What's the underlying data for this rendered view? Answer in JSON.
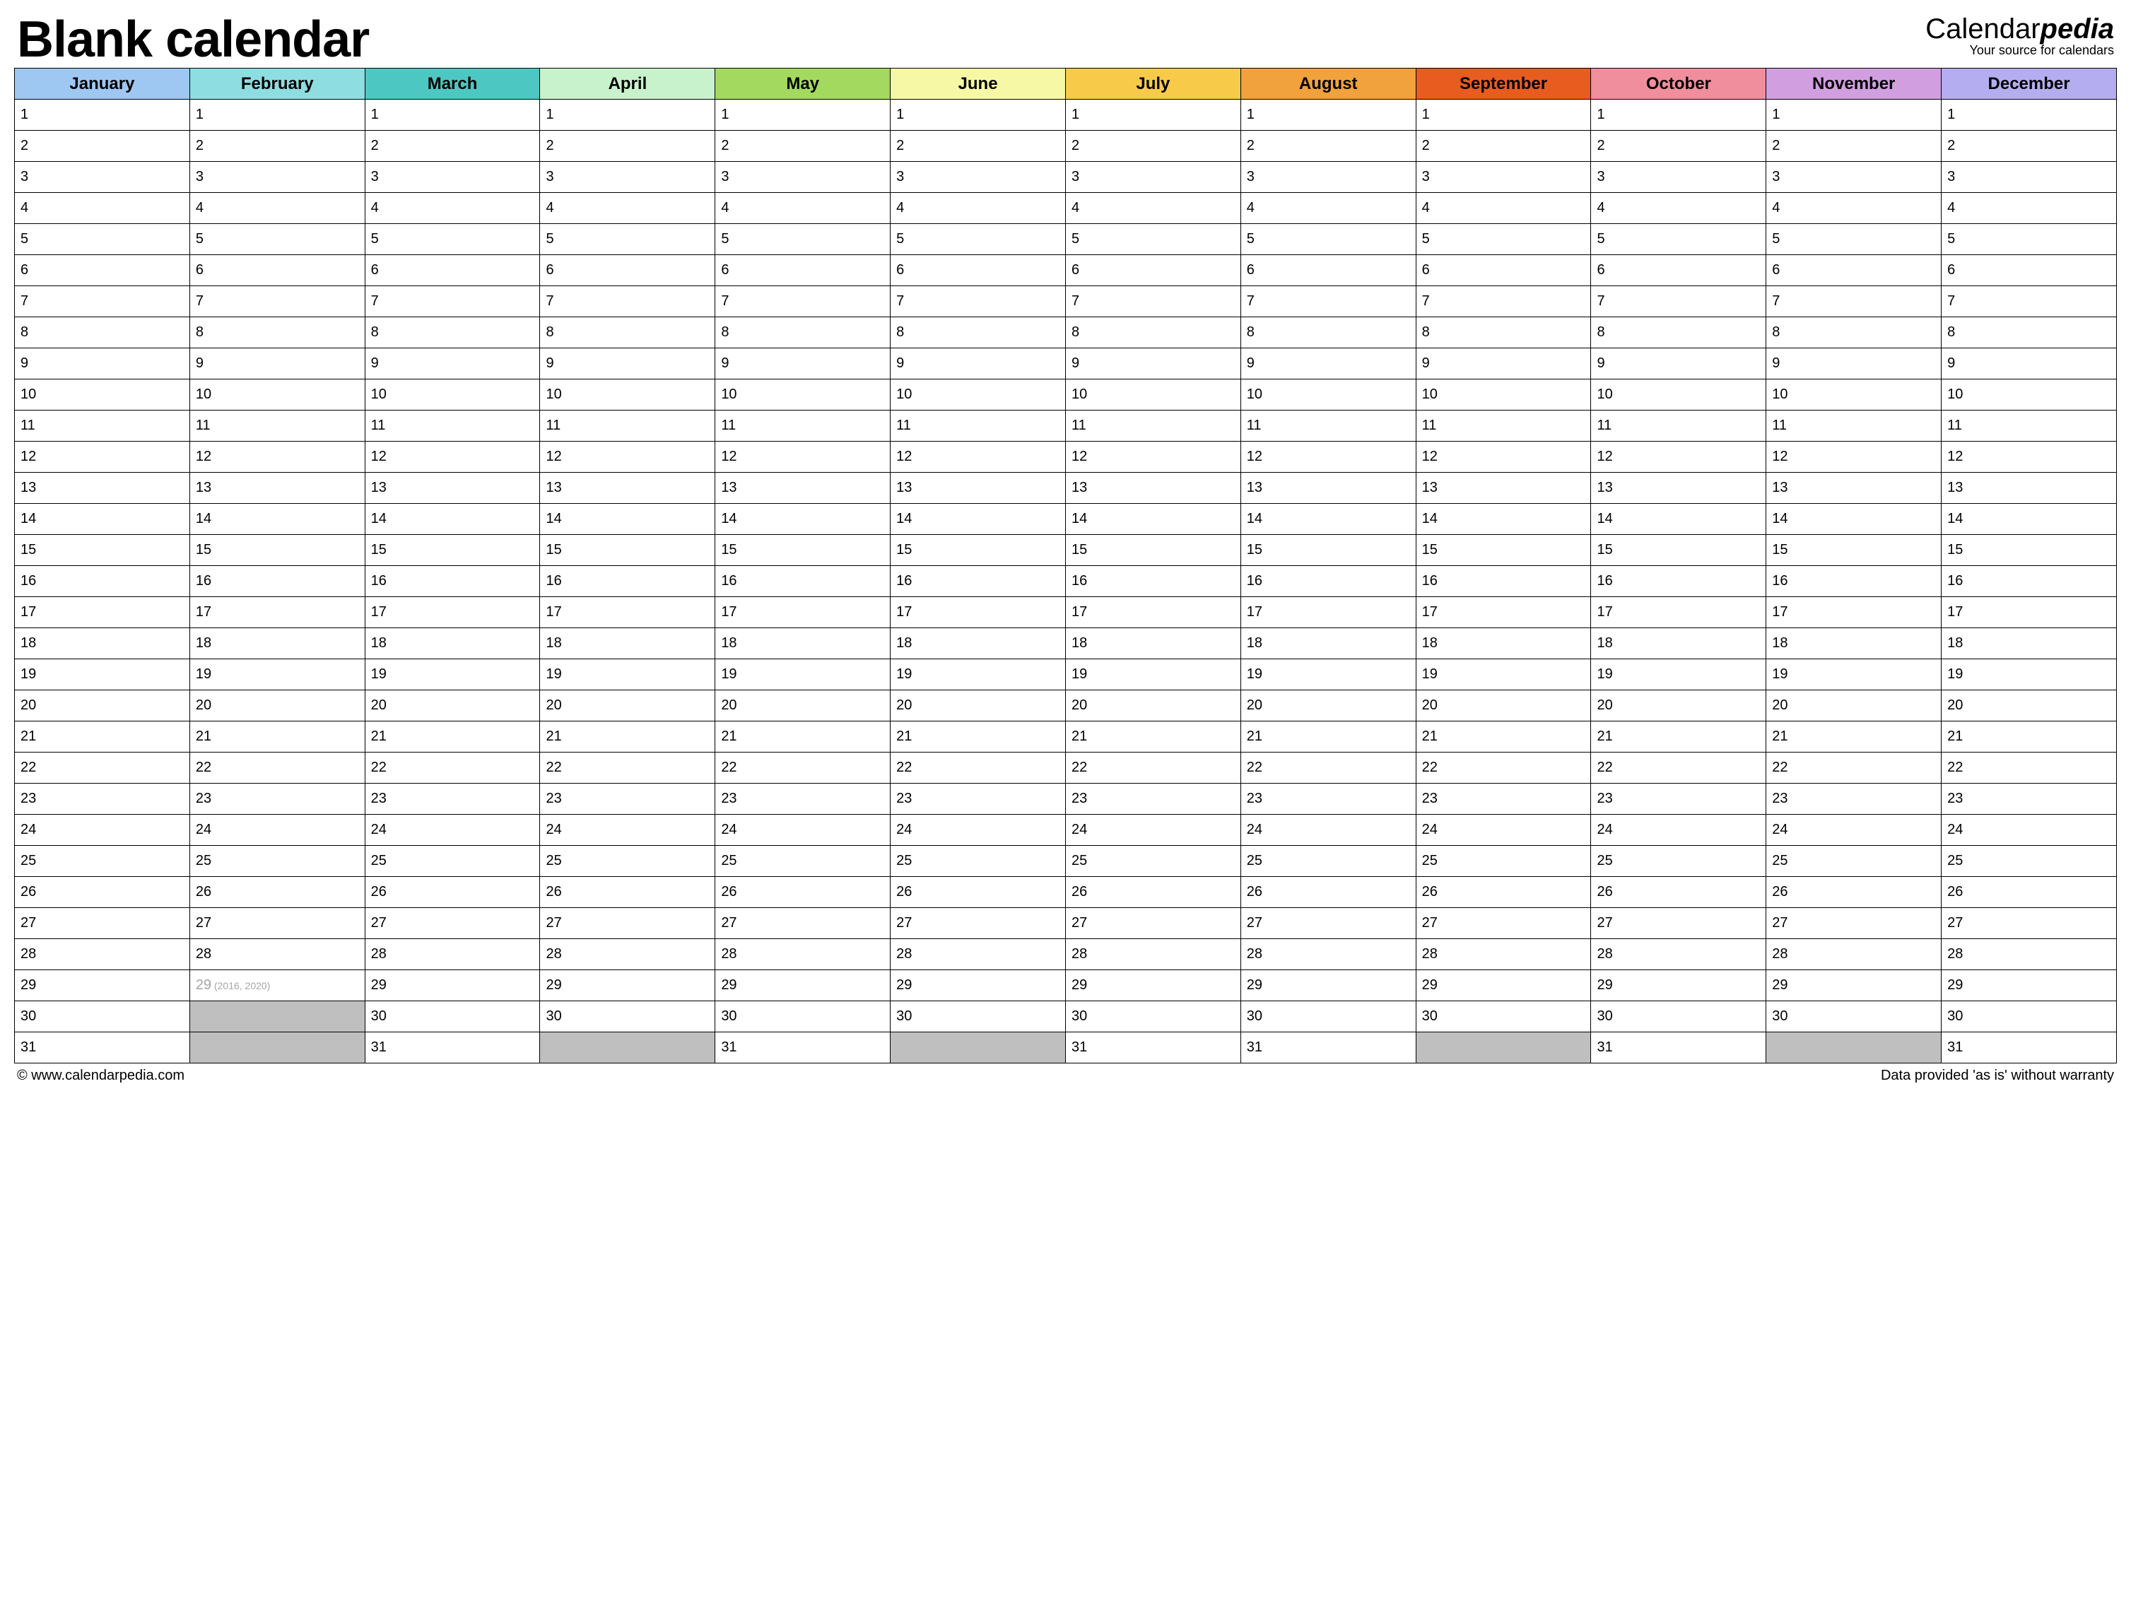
{
  "header": {
    "title": "Blank calendar",
    "brand_prefix": "Calendar",
    "brand_accent": "pedia",
    "brand_tagline": "Your source for calendars"
  },
  "months": [
    {
      "name": "January",
      "color": "#9ec7f2",
      "max_day": 31
    },
    {
      "name": "February",
      "color": "#8edde0",
      "max_day": 29,
      "leap_years_note": "(2016, 2020)"
    },
    {
      "name": "March",
      "color": "#4dc7c1",
      "max_day": 31
    },
    {
      "name": "April",
      "color": "#c8f2cb",
      "max_day": 30
    },
    {
      "name": "May",
      "color": "#a3d95f",
      "max_day": 31
    },
    {
      "name": "June",
      "color": "#f6f8a5",
      "max_day": 30
    },
    {
      "name": "July",
      "color": "#f7ca4a",
      "max_day": 31
    },
    {
      "name": "August",
      "color": "#f2a23c",
      "max_day": 31
    },
    {
      "name": "September",
      "color": "#e95c1f",
      "max_day": 30
    },
    {
      "name": "October",
      "color": "#f08e9e",
      "max_day": 31
    },
    {
      "name": "November",
      "color": "#d19fe0",
      "max_day": 30
    },
    {
      "name": "December",
      "color": "#b4aef0",
      "max_day": 31
    }
  ],
  "rows": 31,
  "footer": {
    "left": "© www.calendarpedia.com",
    "right": "Data provided 'as is' without warranty"
  }
}
